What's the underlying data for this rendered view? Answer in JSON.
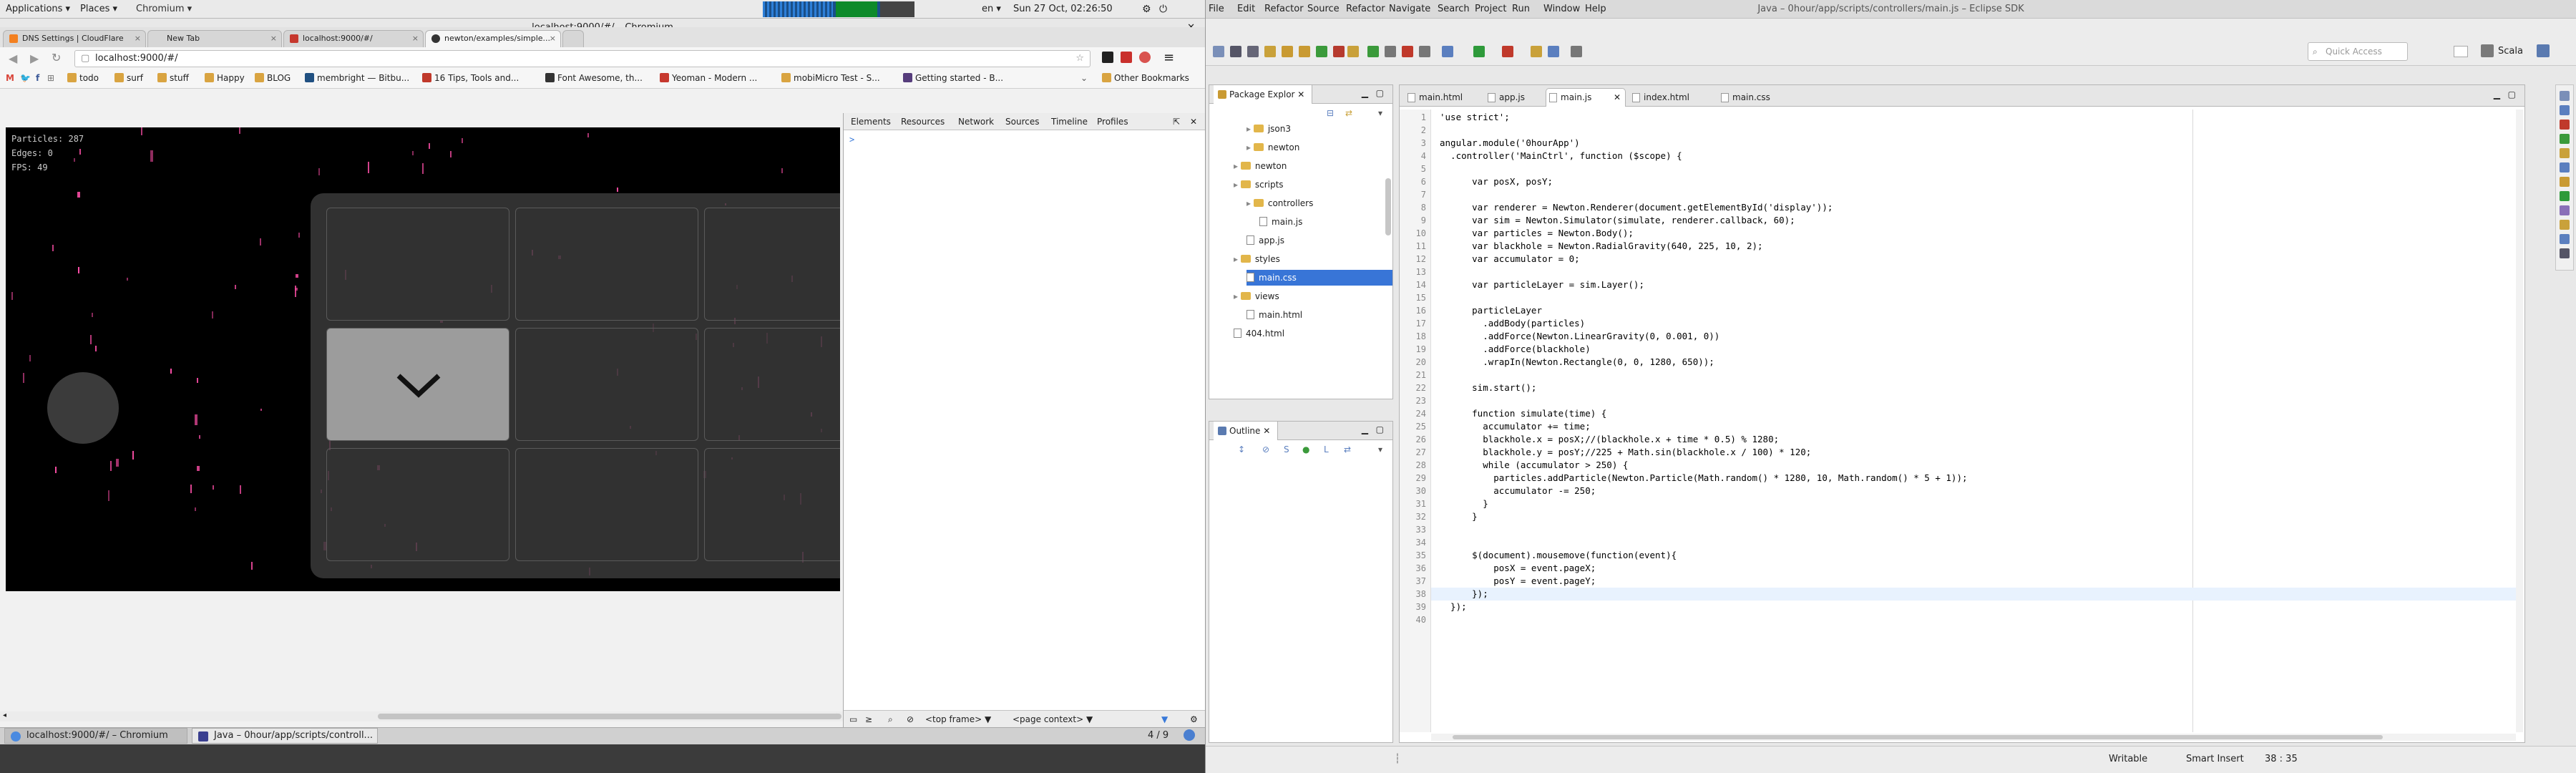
{
  "gnome": {
    "applications": "Applications ▾",
    "places": "Places ▾",
    "active_app": "Chromium ▾",
    "keyboard": "en ▾",
    "datetime": "Sun 27 Oct, 02:26:50"
  },
  "chromium": {
    "window_title": "localhost:9000/#/ – Chromium",
    "tabs": [
      {
        "label": "DNS Settings | CloudFlare",
        "color": "#f38020"
      },
      {
        "label": "New Tab",
        "color": "#cccccc"
      },
      {
        "label": "localhost:9000/#/",
        "color": "#c6382e"
      },
      {
        "label": "newton/examples/simple...",
        "color": "#333333"
      }
    ],
    "url": "localhost:9000/#/",
    "bookmarks": [
      "todo",
      "surf",
      "stuff",
      "Happy",
      "BLOG",
      "membright — Bitbu...",
      "16 Tips, Tools and...",
      "Font Awesome, th...",
      "Yeoman - Modern ...",
      "mobiMicro Test - S...",
      "Getting started - B..."
    ],
    "other_bookmarks": "Other Bookmarks"
  },
  "page": {
    "stats": [
      "Particles: 287",
      "Edges: 0",
      "FPS: 49"
    ],
    "selected_cell_icon": "chevron-down-icon"
  },
  "devtools": {
    "tabs": [
      "Elements",
      "Resources",
      "Network",
      "Sources",
      "Timeline",
      "Profiles"
    ],
    "console_prompt": ">",
    "frame": "<top frame> ▼",
    "context": "<page context> ▼"
  },
  "taskbar": {
    "items": [
      "localhost:9000/#/ – Chromium",
      "Java – 0hour/app/scripts/controll..."
    ],
    "workspace": "4 / 9"
  },
  "eclipse": {
    "window_title": "Java – 0hour/app/scripts/controllers/main.js – Eclipse SDK",
    "menu": [
      "File",
      "Edit",
      "Refactor",
      "Source",
      "Refactor",
      "Navigate",
      "Search",
      "Project",
      "Run",
      "Window",
      "Help"
    ],
    "quick_access": "Quick Access",
    "perspective": "Scala",
    "package_explorer_title": "Package Explor",
    "tree": [
      {
        "label": "json3",
        "type": "folder",
        "indent": 2
      },
      {
        "label": "newton",
        "type": "folder",
        "indent": 2
      },
      {
        "label": "newton",
        "type": "folder",
        "indent": 1
      },
      {
        "label": "scripts",
        "type": "folder",
        "indent": 1
      },
      {
        "label": "controllers",
        "type": "folder",
        "indent": 2
      },
      {
        "label": "main.js",
        "type": "file",
        "indent": 3
      },
      {
        "label": "app.js",
        "type": "file",
        "indent": 2
      },
      {
        "label": "styles",
        "type": "folder",
        "indent": 1
      },
      {
        "label": "main.css",
        "type": "file",
        "indent": 2,
        "selected": true
      },
      {
        "label": "views",
        "type": "folder",
        "indent": 1
      },
      {
        "label": "main.html",
        "type": "file",
        "indent": 2
      },
      {
        "label": "404.html",
        "type": "file",
        "indent": 1
      }
    ],
    "outline_title": "Outline",
    "editor_tabs": [
      "main.html",
      "app.js",
      "main.js",
      "index.html",
      "main.css"
    ],
    "active_editor_tab": 2,
    "code": [
      "'use strict';",
      "",
      "angular.module('0hourApp')",
      "  .controller('MainCtrl', function ($scope) {",
      "",
      "      var posX, posY;",
      "",
      "      var renderer = Newton.Renderer(document.getElementById('display'));",
      "      var sim = Newton.Simulator(simulate, renderer.callback, 60);",
      "      var particles = Newton.Body();",
      "      var blackhole = Newton.RadialGravity(640, 225, 10, 2);",
      "      var accumulator = 0;",
      "",
      "      var particleLayer = sim.Layer();",
      "",
      "      particleLayer",
      "        .addBody(particles)",
      "        .addForce(Newton.LinearGravity(0, 0.001, 0))",
      "        .addForce(blackhole)",
      "        .wrapIn(Newton.Rectangle(0, 0, 1280, 650));",
      "",
      "      sim.start();",
      "",
      "      function simulate(time) {",
      "        accumulator += time;",
      "        blackhole.x = posX;//(blackhole.x + time * 0.5) % 1280;",
      "        blackhole.y = posY;//225 + Math.sin(blackhole.x / 100) * 120;",
      "        while (accumulator > 250) {",
      "          particles.addParticle(Newton.Particle(Math.random() * 1280, 10, Math.random() * 5 + 1));",
      "          accumulator -= 250;",
      "        }",
      "      }",
      "",
      "",
      "      $(document).mousemove(function(event){",
      "          posX = event.pageX;",
      "          posY = event.pageY;",
      "      });",
      "  });",
      ""
    ],
    "status": {
      "writable": "Writable",
      "insert_mode": "Smart Insert",
      "position": "38 : 35"
    }
  }
}
